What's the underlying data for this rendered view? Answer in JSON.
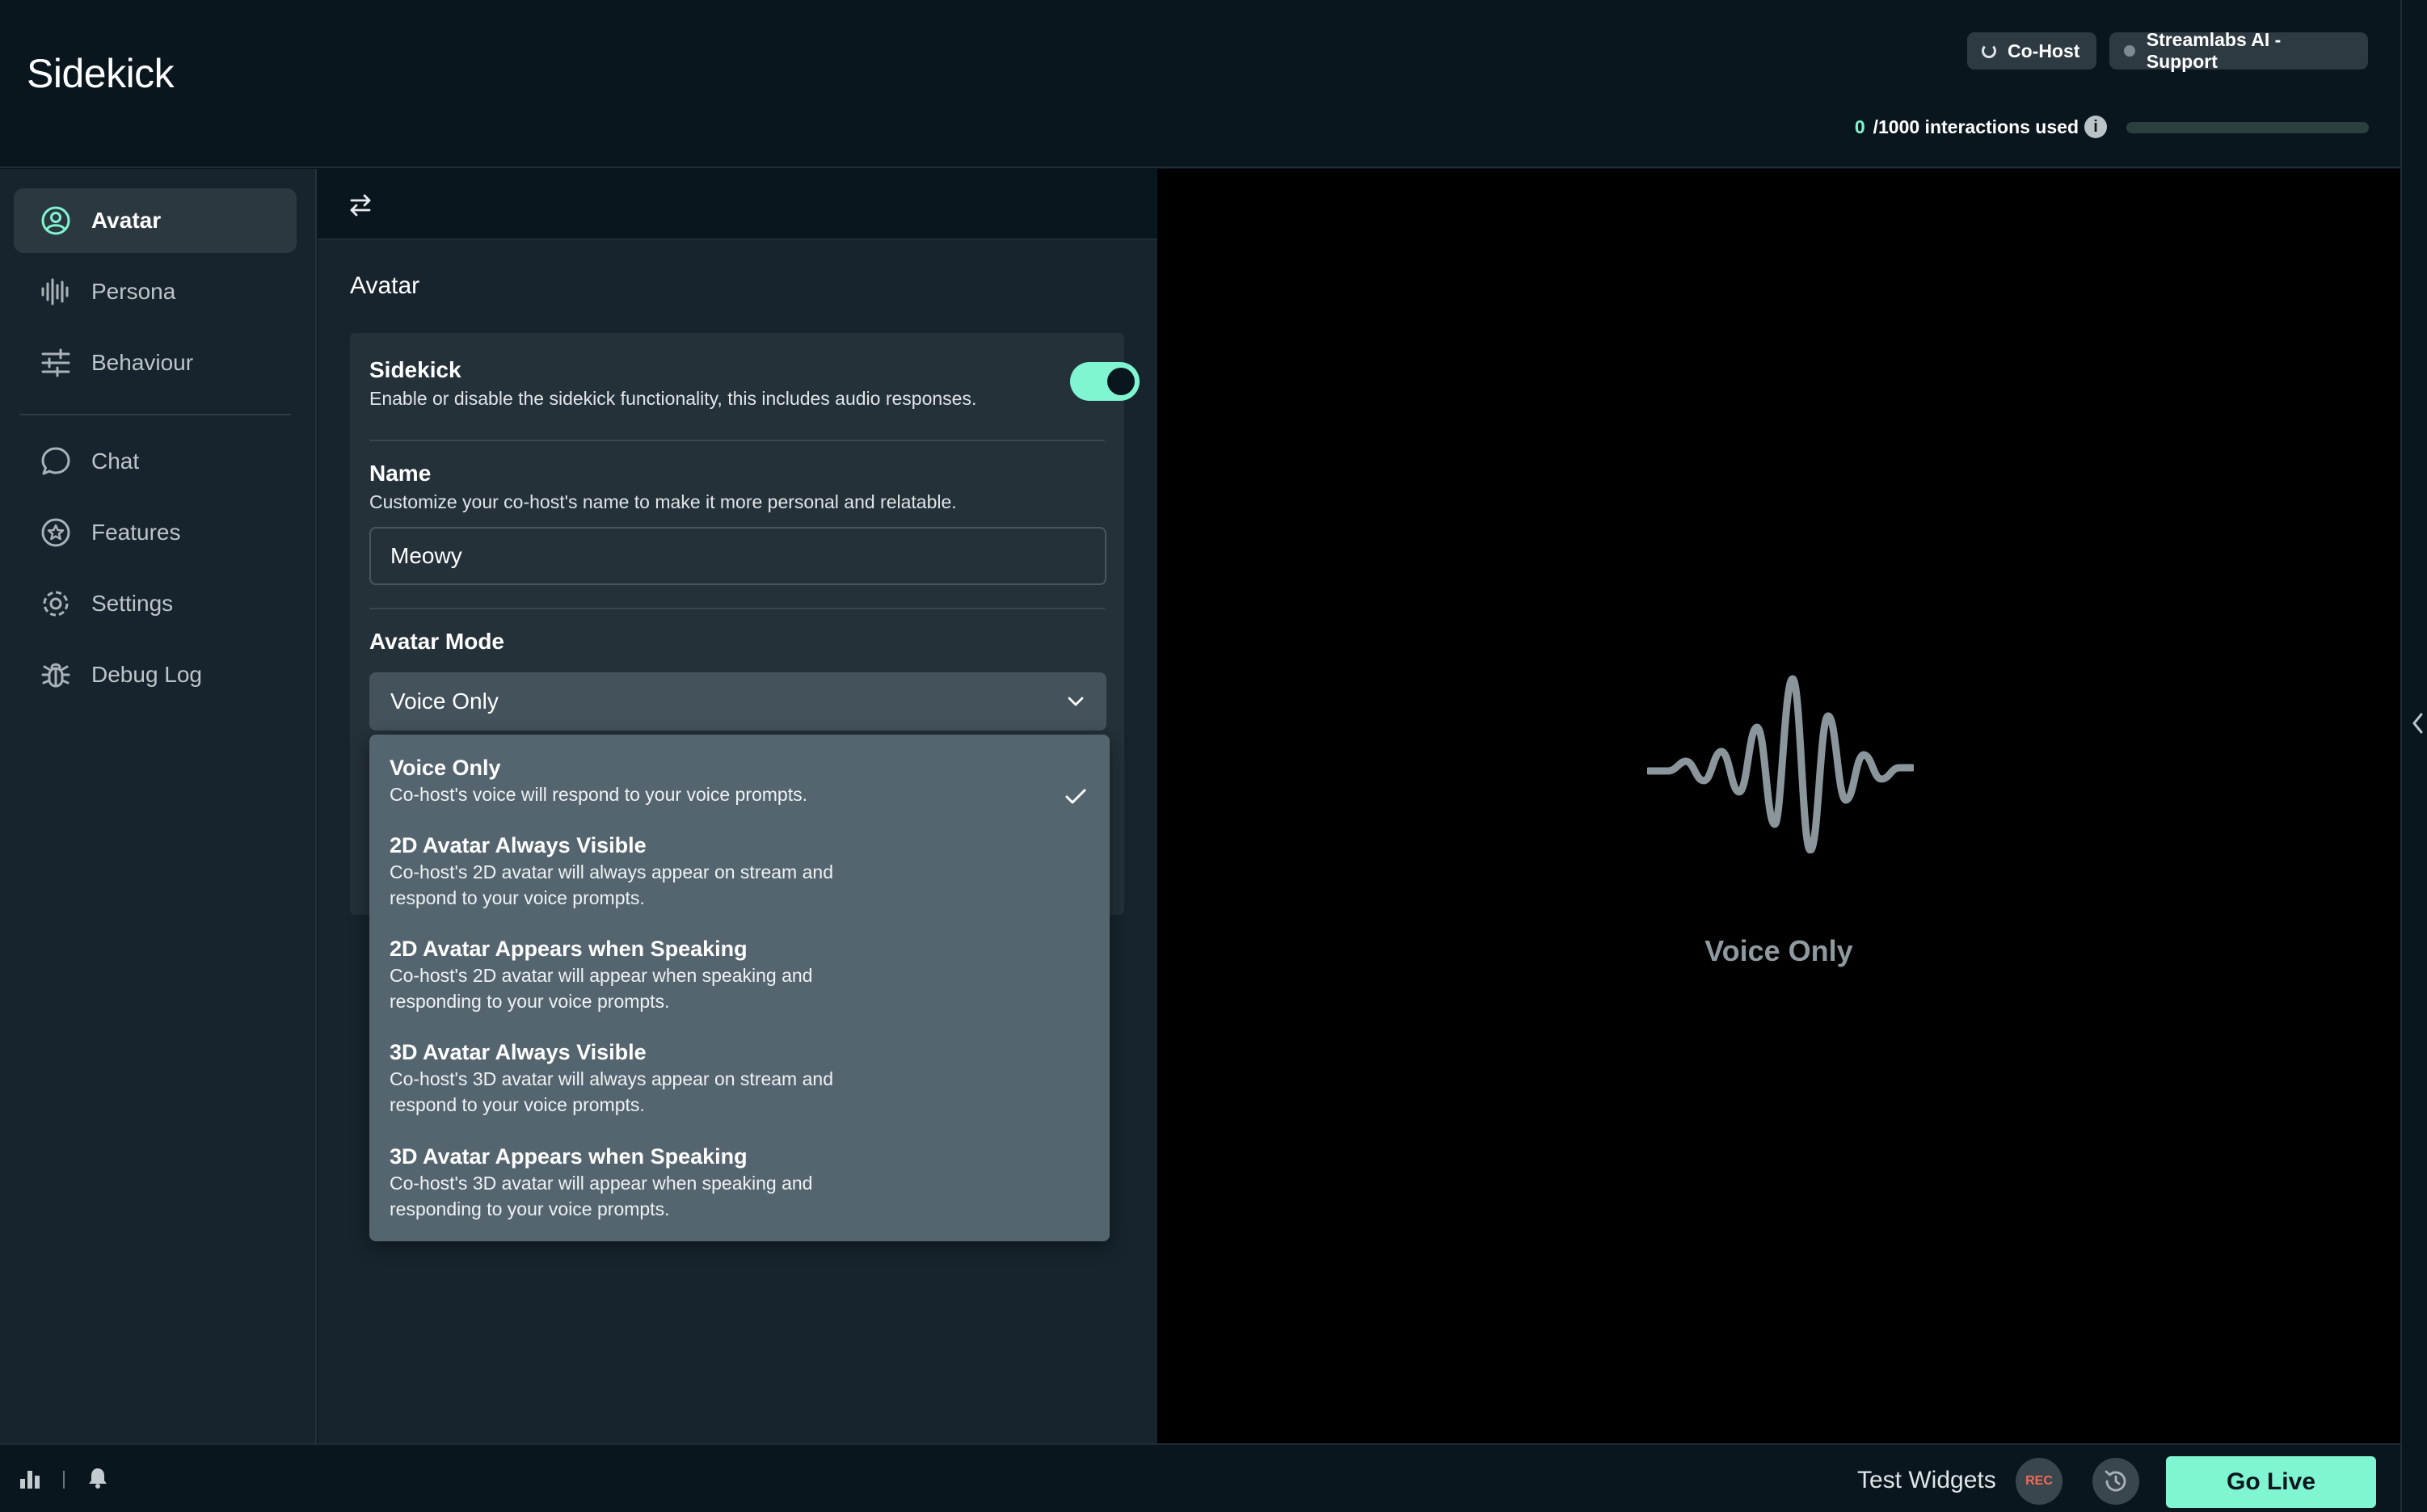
{
  "app": {
    "title": "Sidekick"
  },
  "header": {
    "cohost_label": "Co-Host",
    "support_label": "Streamlabs AI - Support",
    "usage": {
      "used": "0",
      "suffix": "/1000 interactions used",
      "info_icon": "info-icon"
    },
    "usage_progress": 0
  },
  "sidebar": {
    "items": [
      {
        "label": "Avatar",
        "icon": "user-circle-icon",
        "active": true
      },
      {
        "label": "Persona",
        "icon": "soundwave-icon",
        "active": false
      },
      {
        "label": "Behaviour",
        "icon": "sliders-icon",
        "active": false
      },
      {
        "label": "Chat",
        "icon": "chat-bubble-icon",
        "active": false
      },
      {
        "label": "Features",
        "icon": "star-badge-icon",
        "active": false
      },
      {
        "label": "Settings",
        "icon": "gear-icon",
        "active": false
      },
      {
        "label": "Debug Log",
        "icon": "bug-icon",
        "active": false
      }
    ]
  },
  "panel": {
    "toolbar_icon": "swap-arrows-icon",
    "title": "Avatar",
    "sidekick": {
      "title": "Sidekick",
      "description": "Enable or disable the sidekick functionality, this includes audio responses.",
      "enabled": true
    },
    "name": {
      "title": "Name",
      "description": "Customize your co-host's name to make it more personal and relatable.",
      "value": "Meowy"
    },
    "avatar_mode": {
      "title": "Avatar Mode",
      "selected": "Voice Only",
      "chevron_icon": "chevron-down-icon"
    }
  },
  "dropdown": {
    "options": [
      {
        "title": "Voice Only",
        "desc": "Co-host's voice will respond to your voice prompts.",
        "selected": true
      },
      {
        "title": "2D Avatar Always Visible",
        "desc": "Co-host's 2D avatar will always appear on stream and respond to your voice prompts.",
        "selected": false
      },
      {
        "title": "2D Avatar Appears when Speaking",
        "desc": "Co-host's 2D avatar will appear when speaking and responding to your voice prompts.",
        "selected": false
      },
      {
        "title": "3D Avatar Always Visible",
        "desc": "Co-host's 3D avatar will always appear on stream and respond to your voice prompts.",
        "selected": false
      },
      {
        "title": "3D Avatar Appears when Speaking",
        "desc": "Co-host's 3D avatar will appear when speaking and responding to your voice prompts.",
        "selected": false
      }
    ]
  },
  "preview": {
    "label": "Voice Only",
    "icon": "waveform-icon"
  },
  "footer": {
    "stats_icon": "bar-chart-icon",
    "bell_icon": "bell-icon",
    "test_widgets": "Test Widgets",
    "rec_label": "REC",
    "history_icon": "history-icon",
    "go_live": "Go Live"
  },
  "colors": {
    "accent": "#80f5d2",
    "background": "#09161d",
    "sidebar": "#17242d",
    "card": "#243139",
    "dropdown": "#55656f",
    "rec": "#ef6b57"
  }
}
